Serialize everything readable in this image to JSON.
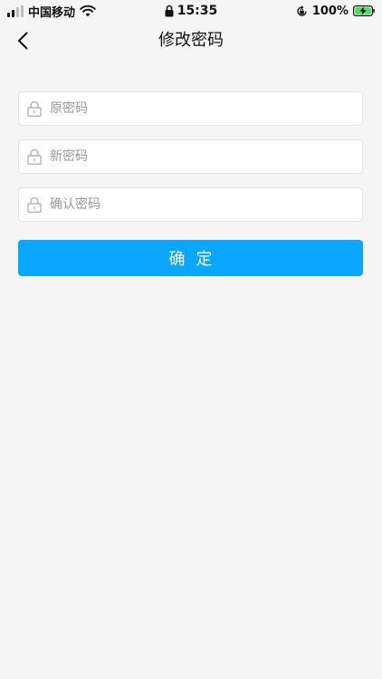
{
  "status_bar": {
    "carrier": "中国移动",
    "time": "15:35",
    "battery_percent": "100%",
    "icons": [
      "signal-icon",
      "wifi-icon",
      "lock-icon",
      "rotation-lock-icon",
      "battery-charging-icon"
    ]
  },
  "nav": {
    "title": "修改密码",
    "back_icon": "chevron-left-icon"
  },
  "form": {
    "old_password": {
      "placeholder": "原密码",
      "value": ""
    },
    "new_password": {
      "placeholder": "新密码",
      "value": ""
    },
    "confirm_password": {
      "placeholder": "确认密码",
      "value": ""
    },
    "field_icon": "lock-icon"
  },
  "actions": {
    "confirm_label": "确定"
  },
  "colors": {
    "background": "#f5f5f5",
    "primary": "#0aa6ff",
    "border": "#e4e4e4",
    "placeholder": "#999999",
    "battery": "#4cd964"
  }
}
